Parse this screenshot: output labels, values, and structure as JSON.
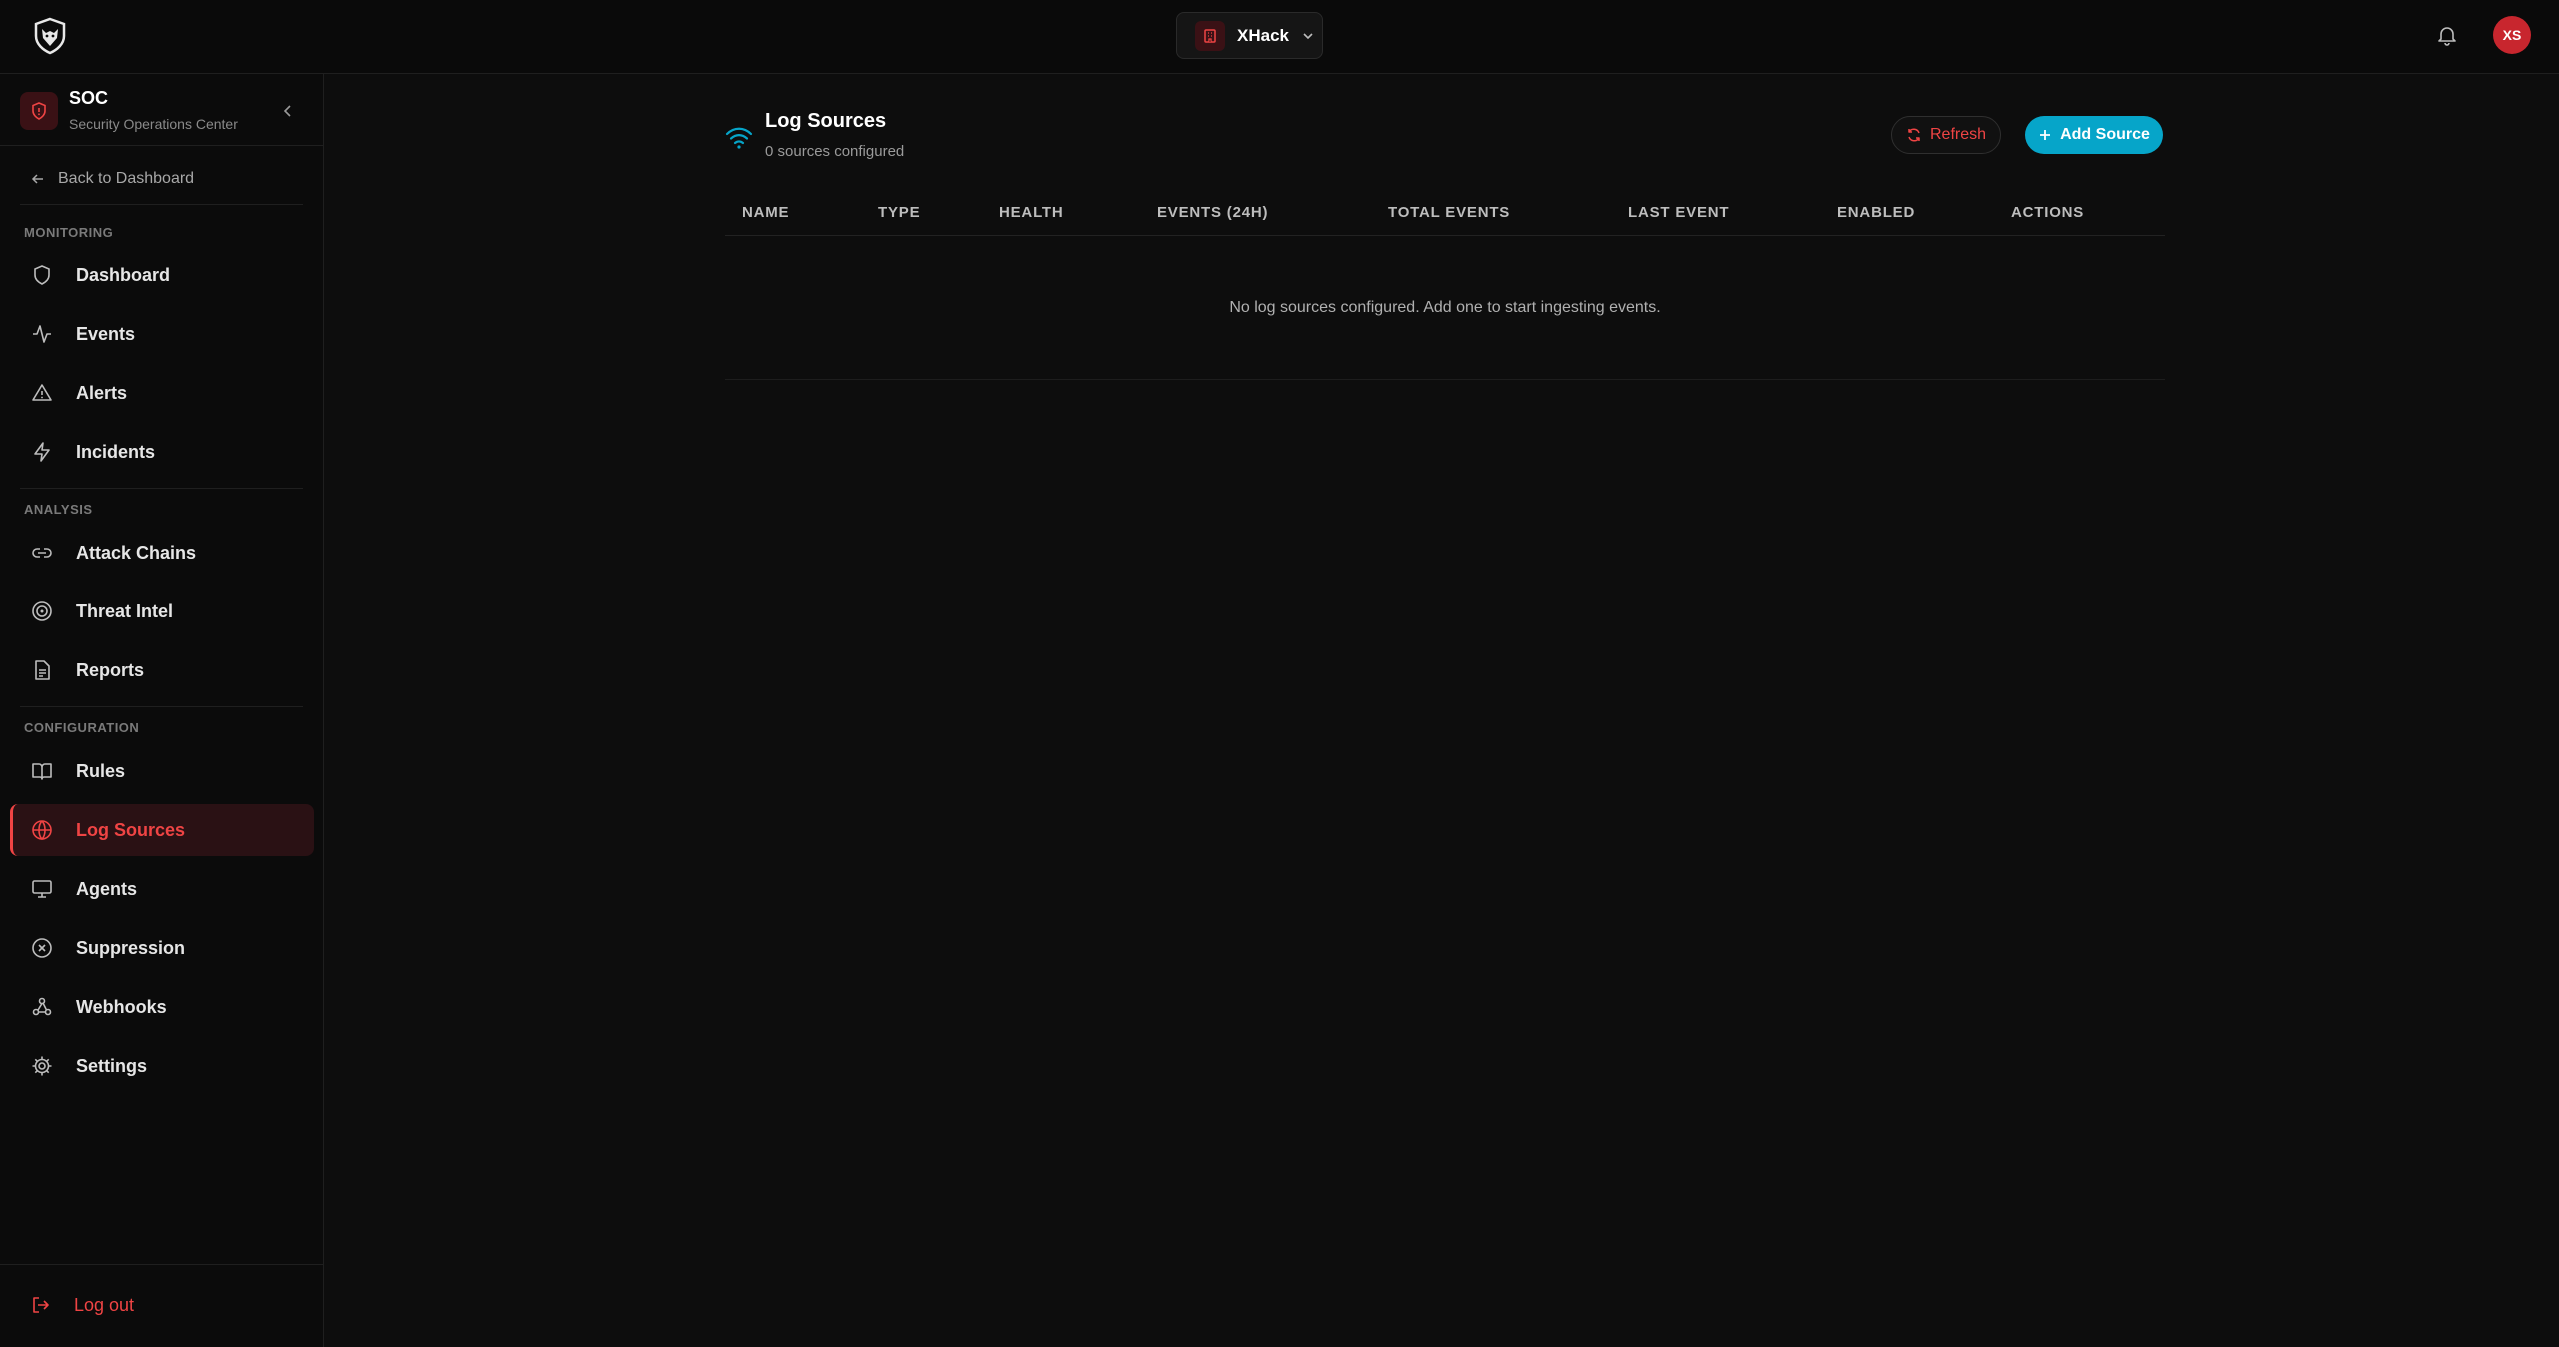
{
  "topbar": {
    "workspace_name": "XHack",
    "avatar_initials": "XS"
  },
  "sidebar": {
    "title": "SOC",
    "subtitle": "Security Operations Center",
    "back_label": "Back to Dashboard",
    "sections": {
      "monitoring": "MONITORING",
      "analysis": "ANALYSIS",
      "configuration": "CONFIGURATION"
    },
    "items": {
      "dashboard": "Dashboard",
      "events": "Events",
      "alerts": "Alerts",
      "incidents": "Incidents",
      "attack_chains": "Attack Chains",
      "threat_intel": "Threat Intel",
      "reports": "Reports",
      "rules": "Rules",
      "log_sources": "Log Sources",
      "agents": "Agents",
      "suppression": "Suppression",
      "webhooks": "Webhooks",
      "settings": "Settings"
    },
    "active_item": "log_sources",
    "logout_label": "Log out"
  },
  "main": {
    "title": "Log Sources",
    "subtitle": "0 sources configured",
    "refresh_label": "Refresh",
    "add_label": "Add Source",
    "table": {
      "columns": [
        "NAME",
        "TYPE",
        "HEALTH",
        "EVENTS (24H)",
        "TOTAL EVENTS",
        "LAST EVENT",
        "ENABLED",
        "ACTIONS"
      ],
      "empty_message": "No log sources configured. Add one to start ingesting events."
    }
  },
  "colors": {
    "accent_red": "#ef4444",
    "accent_cyan": "#06a5c9",
    "background": "#0d0d0d"
  }
}
